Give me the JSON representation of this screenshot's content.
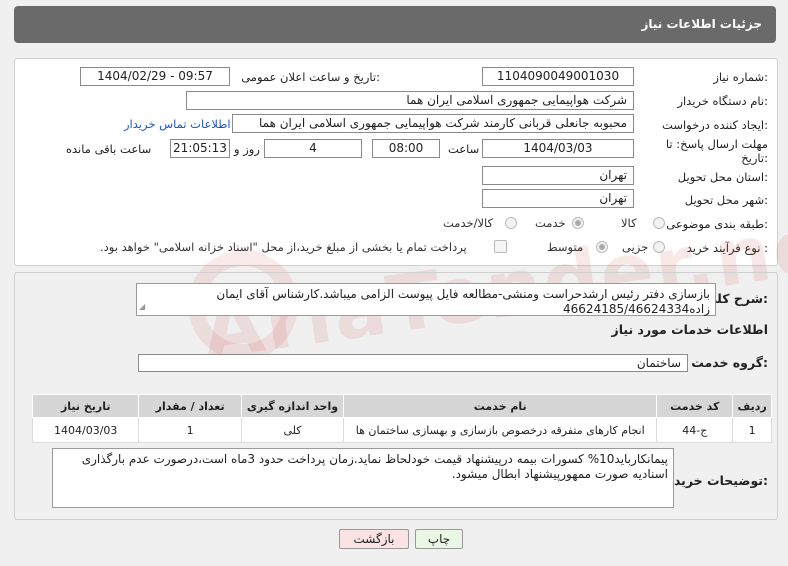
{
  "header": {
    "title": "جزئیات اطلاعات نیاز"
  },
  "form": {
    "need_number_label": "شماره نیاز:",
    "need_number": "1104090049001030",
    "announce_label": "تاریخ و ساعت اعلان عمومی:",
    "announce_value": "1404/02/29 - 09:57",
    "buyer_org_label": "نام دستگاه خریدار:",
    "buyer_org": "شرکت هواپیمایی جمهوری اسلامی ایران هما",
    "creator_label": "ایجاد کننده درخواست:",
    "creator": "محبوبه جانعلی قربانی کارمند شرکت هواپیمایی جمهوری اسلامی ایران هما",
    "contact_link": "اطلاعات تماس خریدار",
    "deadline_label_1": "مهلت ارسال پاسخ: تا",
    "deadline_label_2": "تاریخ:",
    "deadline_date": "1404/03/03",
    "time_label": "ساعت",
    "deadline_time": "08:00",
    "days_value": "4",
    "days_label": "روز و",
    "remaining_time": "21:05:13",
    "remaining_label": "ساعت باقی مانده",
    "province_label": "استان محل تحویل:",
    "province": "تهران",
    "city_label": "شهر محل تحویل:",
    "city": "تهران",
    "category_label": "طبقه بندی موضوعی:",
    "category_options": [
      "کالا",
      "خدمت",
      "کالا/خدمت"
    ],
    "process_label": "نوع فرآیند خرید :",
    "process_options": [
      "جزیی",
      "متوسط"
    ],
    "payment_text": "پرداخت تمام یا بخشی از مبلغ خرید،از محل \"اسناد خزانه اسلامی\" خواهد بود."
  },
  "summary": {
    "label": "شرح کلی نیاز:",
    "text": "بازسازی دفتر رئیس ارشدحراست ومنشی-مطالعه فایل پیوست الزامی میباشد.کارشناس آقای ایمان زاده46624185/46624334"
  },
  "services": {
    "section_title": "اطلاعات خدمات مورد نیاز",
    "group_label": "گروه خدمت:",
    "group_value": "ساختمان",
    "columns": [
      "ردیف",
      "کد خدمت",
      "نام خدمت",
      "واحد اندازه گیری",
      "تعداد / مقدار",
      "تاریخ نیاز"
    ],
    "rows": [
      [
        "1",
        "ج-44",
        "انجام کارهای متفرقه درخصوص بازسازی و بهسازی ساختمان ها",
        "کلی",
        "1",
        "1404/03/03"
      ]
    ]
  },
  "buyer_notes": {
    "label": "توضیحات خریدار:",
    "text": "پیمانکارباید10% کسورات بیمه درپیشنهاد قیمت خودلحاظ نماید.زمان پرداخت حدود 3ماه است،درصورت عدم بارگذاری اسنادیه صورت ممهورپیشنهاد ابطال میشود."
  },
  "buttons": {
    "print": "چاپ",
    "back": "بازگشت"
  },
  "watermark": "AriaTender.neT"
}
